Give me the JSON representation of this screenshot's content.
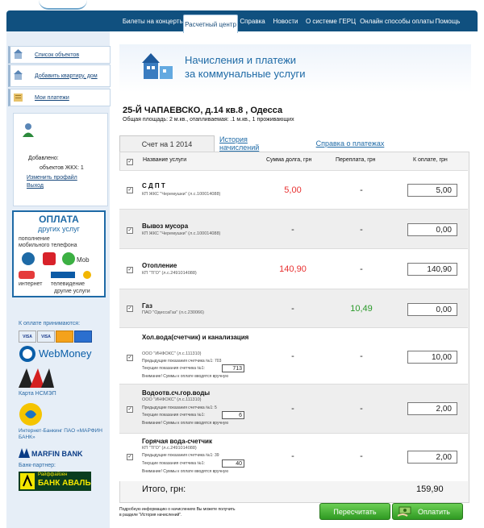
{
  "nav": {
    "items": [
      {
        "label": "Билеты на концерты"
      },
      {
        "label": "Расчетный центр"
      },
      {
        "label": "Справка"
      },
      {
        "label": "Новости"
      },
      {
        "label": "О системе ГЕРЦ"
      },
      {
        "label": "Онлайн способы оплаты"
      },
      {
        "label": "Помощь"
      }
    ],
    "active": "Расчетный центр"
  },
  "sidebar": {
    "menu": [
      {
        "label": "Список объектов"
      },
      {
        "label": "Добавить квартиру, дом"
      },
      {
        "label": "Мои платежи"
      }
    ],
    "user": {
      "added_label": "Добавлено:",
      "objects_label": "объектов ЖКХ: 1",
      "profile_link": "Изменить профайл",
      "logout_link": "Выход"
    },
    "promo": {
      "title": "ОПЛАТА",
      "subtitle": "других услуг",
      "line1": "пополнение",
      "line2": "мобильного телефона",
      "internet": "интернет",
      "tv": "телевидение",
      "other": "другие услуги"
    },
    "accept_title": "К оплате принимаются:",
    "card_visa": "VISA",
    "webmoney": "WebMoney",
    "nsmep": "Карта НСМЭП",
    "banking": "Интернет-Банкинг ПАО «МАРФИН БАНК»",
    "marfin": "MARFIN BANK",
    "partner_title": "Банк-партнер:",
    "aval_small": "Райффайзен",
    "aval": "БАНК АВАЛЬ"
  },
  "page": {
    "title_line1": "Начисления и платежи",
    "title_line2": "за коммунальные услуги",
    "address": "25-Й ЧАПАЕВСКО, д.14 кв.8 , Одесса",
    "address_sub": "Общая площадь: 2  м.кв., отапливаемая:  .1 м.кв., 1 проживающих"
  },
  "tabs": [
    {
      "label": "Счет на 1 2014"
    },
    {
      "label": "История начислений"
    },
    {
      "label": "Справка о платежах"
    }
  ],
  "table": {
    "headers": {
      "service": "Название услуги",
      "debt": "Сумма долга, грн",
      "overpay": "Переплата, грн",
      "topay": "К оплате, грн"
    },
    "rows": [
      {
        "name": "С Д П Т",
        "provider": "КП ЖКС \"Черемушки\"",
        "acc": "(л.с.100014088)",
        "debt": "5,00",
        "overpay": "-",
        "topay": "5,00"
      },
      {
        "name": "Вывоз мусора",
        "provider": "КП ЖКС \"Черемушки\"",
        "acc": "(л.с.100014088)",
        "debt": "-",
        "overpay": "-",
        "topay": "0,00"
      },
      {
        "name": "Отопление",
        "provider": "КП \"ТГО\"",
        "acc": "(л.с.2491014088)",
        "debt": "140,90",
        "overpay": "-",
        "topay": "140,90"
      },
      {
        "name": "Газ",
        "provider": "ПАО \"ОдессаГаз\"",
        "acc": "(л.с.230066)",
        "debt": "-",
        "overpay": "10,49",
        "topay": "0,00"
      },
      {
        "name": "Хол.вода(счетчик) и канализация",
        "provider": "ООО \"ИНФОКС\"",
        "acc": "(л.с.111310)",
        "prev": "Предыдущие показания счетчика №1: 703",
        "cur": "Текущие показания счетчика №1:",
        "cur_val": "713",
        "warn": "Внимание! Суммы к оплате вводятся вручную",
        "debt": "-",
        "overpay": "-",
        "topay": "10,00"
      },
      {
        "name": "Водоотв.сч.гор.воды",
        "provider": "ООО \"ИНФОКС\"",
        "acc": "(л.с.111310)",
        "prev": "Предыдущие показания счетчика №1: 5",
        "cur": "Текущие показания счетчика №1:",
        "cur_val": "6",
        "warn": "Внимание! Суммы к оплате вводятся вручную",
        "debt": "-",
        "overpay": "-",
        "topay": "2,00"
      },
      {
        "name": "Горячая вода-счетчик",
        "provider": "КП \"ТГО\"",
        "acc": "(л.с.2491014088)",
        "prev": "Предыдущие показания счетчика №1: 39",
        "cur": "Текущие показания счетчика №1:",
        "cur_val": "40",
        "warn": "Внимание! Суммы к оплате вводятся вручную",
        "debt": "-",
        "overpay": "-",
        "topay": "2,00"
      }
    ],
    "total_label": "Итого, грн:",
    "total_value": "159,90"
  },
  "footer": {
    "note_line1": "Подробную информацию о начислениях Вы можете получить",
    "note_line2": "в разделе \"История начислений\".",
    "recalc_button": "Пересчитать",
    "pay_button": "Оплатить"
  },
  "colors": {
    "nav_bg": "#10507f",
    "debt_red": "#e83030",
    "overpay_green": "#2a9a2a",
    "button_green": "#3caa2c"
  }
}
